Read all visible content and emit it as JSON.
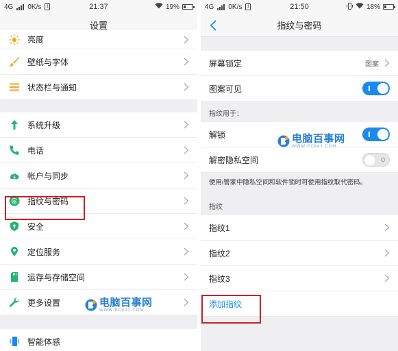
{
  "left_screen": {
    "status": {
      "network": "4G",
      "speed": "0K/s",
      "time": "21:37",
      "battery": "19%"
    },
    "title": "设置",
    "items": [
      {
        "label": "亮度",
        "icon": "brightness-icon",
        "color": "#f5a623"
      },
      {
        "label": "壁纸与字体",
        "icon": "brush-icon",
        "color": "#f5a623"
      },
      {
        "label": "状态栏与通知",
        "icon": "list-icon",
        "color": "#f5a623"
      },
      {
        "label": "系统升级",
        "icon": "arrow-up-icon",
        "color": "#22b573"
      },
      {
        "label": "电话",
        "icon": "phone-icon",
        "color": "#22b573"
      },
      {
        "label": "帐户与同步",
        "icon": "cloud-icon",
        "color": "#22b573"
      },
      {
        "label": "指纹与密码",
        "icon": "fingerprint-icon",
        "color": "#22b573"
      },
      {
        "label": "安全",
        "icon": "shield-icon",
        "color": "#22b573"
      },
      {
        "label": "定位服务",
        "icon": "location-icon",
        "color": "#22b573"
      },
      {
        "label": "运存与存储空间",
        "icon": "sd-card-icon",
        "color": "#22b573"
      },
      {
        "label": "更多设置",
        "icon": "wrench-icon",
        "color": "#22b573"
      },
      {
        "label": "智能体感",
        "icon": "phone-motion-icon",
        "color": "#1a8bea"
      }
    ]
  },
  "right_screen": {
    "status": {
      "network": "4G",
      "speed": "0K/s",
      "time": "21:50",
      "battery": "18%"
    },
    "title": "指纹与密码",
    "screen_lock": {
      "label": "屏幕锁定",
      "value": "图案"
    },
    "pattern_visible": {
      "label": "图案可见",
      "on": true
    },
    "fingerprint_for_label": "指纹用于：",
    "unlock": {
      "label": "解锁",
      "on": true
    },
    "private_space": {
      "label": "解密隐私空间",
      "on": false
    },
    "note": "使用i管家中隐私空间和软件锁时可使用指纹取代密码。",
    "fingerprint_section_label": "指纹",
    "fingerprints": [
      "指纹1",
      "指纹2",
      "指纹3"
    ],
    "add_fingerprint": "添加指纹"
  },
  "watermark": {
    "text": "电脑百事网",
    "url": "WWW.PC841.COM"
  },
  "colors": {
    "accent": "#1a8bea",
    "highlight": "#cc1f25"
  }
}
